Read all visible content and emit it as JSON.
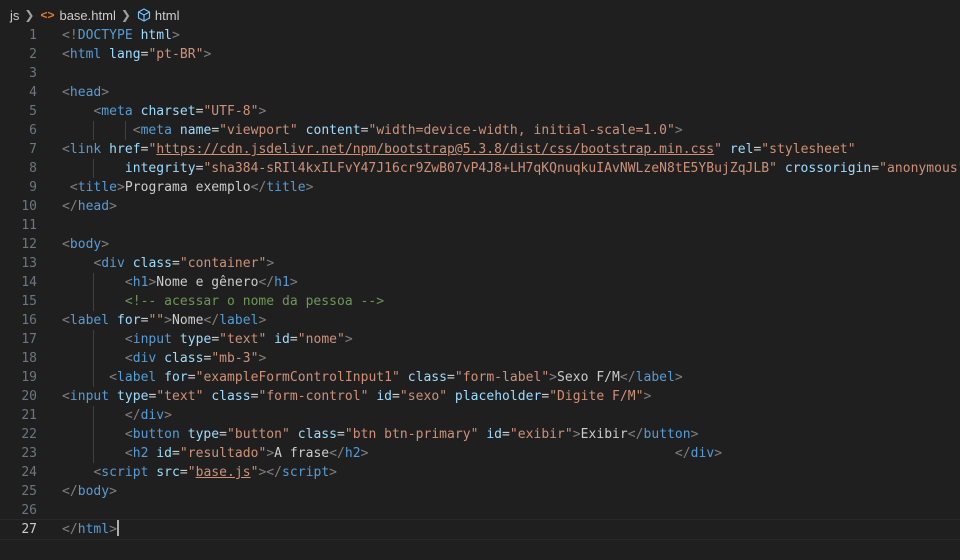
{
  "breadcrumb": {
    "folder": "js",
    "file": "base.html",
    "symbol": "html"
  },
  "editor": {
    "active_line": 27,
    "lines": [
      {
        "n": 1,
        "tokens": [
          [
            "p",
            "<!"
          ],
          [
            "t",
            "DOCTYPE"
          ],
          [
            "x",
            " "
          ],
          [
            "a",
            "html"
          ],
          [
            "p",
            ">"
          ]
        ]
      },
      {
        "n": 2,
        "tokens": [
          [
            "p",
            "<"
          ],
          [
            "t",
            "html"
          ],
          [
            "x",
            " "
          ],
          [
            "a",
            "lang"
          ],
          [
            "x",
            "="
          ],
          [
            "s",
            "\"pt-BR\""
          ],
          [
            "p",
            ">"
          ]
        ]
      },
      {
        "n": 3,
        "tokens": []
      },
      {
        "n": 4,
        "tokens": [
          [
            "p",
            "<"
          ],
          [
            "t",
            "head"
          ],
          [
            "p",
            ">"
          ]
        ]
      },
      {
        "n": 5,
        "tokens": [
          [
            "x",
            "    "
          ],
          [
            "p",
            "<"
          ],
          [
            "t",
            "meta"
          ],
          [
            "x",
            " "
          ],
          [
            "a",
            "charset"
          ],
          [
            "x",
            "="
          ],
          [
            "s",
            "\"UTF-8\""
          ],
          [
            "p",
            ">"
          ]
        ]
      },
      {
        "n": 6,
        "tokens": [
          [
            "x",
            "         "
          ],
          [
            "p",
            "<"
          ],
          [
            "t",
            "meta"
          ],
          [
            "x",
            " "
          ],
          [
            "a",
            "name"
          ],
          [
            "x",
            "="
          ],
          [
            "s",
            "\"viewport\""
          ],
          [
            "x",
            " "
          ],
          [
            "a",
            "content"
          ],
          [
            "x",
            "="
          ],
          [
            "s",
            "\"width=device-width, initial-scale=1.0\""
          ],
          [
            "p",
            ">"
          ]
        ]
      },
      {
        "n": 7,
        "tokens": [
          [
            "p",
            "<"
          ],
          [
            "t",
            "link"
          ],
          [
            "x",
            " "
          ],
          [
            "a",
            "href"
          ],
          [
            "x",
            "="
          ],
          [
            "s",
            "\""
          ],
          [
            "u",
            "https://cdn.jsdelivr.net/npm/bootstrap@5.3.8/dist/css/bootstrap.min.css"
          ],
          [
            "s",
            "\""
          ],
          [
            "x",
            " "
          ],
          [
            "a",
            "rel"
          ],
          [
            "x",
            "="
          ],
          [
            "s",
            "\"stylesheet\""
          ]
        ]
      },
      {
        "n": 8,
        "tokens": [
          [
            "x",
            "        "
          ],
          [
            "a",
            "integrity"
          ],
          [
            "x",
            "="
          ],
          [
            "s",
            "\"sha384-sRIl4kxILFvY47J16cr9ZwB07vP4J8+LH7qKQnuqkuIAvNWLzeN8tE5YBujZqJLB\""
          ],
          [
            "x",
            " "
          ],
          [
            "a",
            "crossorigin"
          ],
          [
            "x",
            "="
          ],
          [
            "s",
            "\"anonymous\""
          ],
          [
            "p",
            ">"
          ]
        ]
      },
      {
        "n": 9,
        "tokens": [
          [
            "x",
            " "
          ],
          [
            "p",
            "<"
          ],
          [
            "t",
            "title"
          ],
          [
            "p",
            ">"
          ],
          [
            "x",
            "Programa exemplo"
          ],
          [
            "p",
            "</"
          ],
          [
            "t",
            "title"
          ],
          [
            "p",
            ">"
          ]
        ]
      },
      {
        "n": 10,
        "tokens": [
          [
            "p",
            "</"
          ],
          [
            "t",
            "head"
          ],
          [
            "p",
            ">"
          ]
        ]
      },
      {
        "n": 11,
        "tokens": []
      },
      {
        "n": 12,
        "tokens": [
          [
            "p",
            "<"
          ],
          [
            "t",
            "body"
          ],
          [
            "p",
            ">"
          ]
        ]
      },
      {
        "n": 13,
        "tokens": [
          [
            "x",
            "    "
          ],
          [
            "p",
            "<"
          ],
          [
            "t",
            "div"
          ],
          [
            "x",
            " "
          ],
          [
            "a",
            "class"
          ],
          [
            "x",
            "="
          ],
          [
            "s",
            "\"container\""
          ],
          [
            "p",
            ">"
          ]
        ]
      },
      {
        "n": 14,
        "tokens": [
          [
            "x",
            "        "
          ],
          [
            "p",
            "<"
          ],
          [
            "t",
            "h1"
          ],
          [
            "p",
            ">"
          ],
          [
            "x",
            "Nome e gênero"
          ],
          [
            "p",
            "</"
          ],
          [
            "t",
            "h1"
          ],
          [
            "p",
            ">"
          ]
        ]
      },
      {
        "n": 15,
        "tokens": [
          [
            "x",
            "        "
          ],
          [
            "c",
            "<!-- acessar o nome da pessoa -->"
          ]
        ]
      },
      {
        "n": 16,
        "tokens": [
          [
            "p",
            "<"
          ],
          [
            "t",
            "label"
          ],
          [
            "x",
            " "
          ],
          [
            "a",
            "for"
          ],
          [
            "x",
            "="
          ],
          [
            "s",
            "\"\""
          ],
          [
            "p",
            ">"
          ],
          [
            "x",
            "Nome"
          ],
          [
            "p",
            "</"
          ],
          [
            "t",
            "label"
          ],
          [
            "p",
            ">"
          ]
        ]
      },
      {
        "n": 17,
        "tokens": [
          [
            "x",
            "        "
          ],
          [
            "p",
            "<"
          ],
          [
            "t",
            "input"
          ],
          [
            "x",
            " "
          ],
          [
            "a",
            "type"
          ],
          [
            "x",
            "="
          ],
          [
            "s",
            "\"text\""
          ],
          [
            "x",
            " "
          ],
          [
            "a",
            "id"
          ],
          [
            "x",
            "="
          ],
          [
            "s",
            "\"nome\""
          ],
          [
            "p",
            ">"
          ]
        ]
      },
      {
        "n": 18,
        "tokens": [
          [
            "x",
            "        "
          ],
          [
            "p",
            "<"
          ],
          [
            "t",
            "div"
          ],
          [
            "x",
            " "
          ],
          [
            "a",
            "class"
          ],
          [
            "x",
            "="
          ],
          [
            "s",
            "\"mb-3\""
          ],
          [
            "p",
            ">"
          ]
        ]
      },
      {
        "n": 19,
        "tokens": [
          [
            "x",
            "      "
          ],
          [
            "p",
            "<"
          ],
          [
            "t",
            "label"
          ],
          [
            "x",
            " "
          ],
          [
            "a",
            "for"
          ],
          [
            "x",
            "="
          ],
          [
            "s",
            "\"exampleFormControlInput1\""
          ],
          [
            "x",
            " "
          ],
          [
            "a",
            "class"
          ],
          [
            "x",
            "="
          ],
          [
            "s",
            "\"form-label\""
          ],
          [
            "p",
            ">"
          ],
          [
            "x",
            "Sexo F/M"
          ],
          [
            "p",
            "</"
          ],
          [
            "t",
            "label"
          ],
          [
            "p",
            ">"
          ]
        ]
      },
      {
        "n": 20,
        "tokens": [
          [
            "p",
            "<"
          ],
          [
            "t",
            "input"
          ],
          [
            "x",
            " "
          ],
          [
            "a",
            "type"
          ],
          [
            "x",
            "="
          ],
          [
            "s",
            "\"text\""
          ],
          [
            "x",
            " "
          ],
          [
            "a",
            "class"
          ],
          [
            "x",
            "="
          ],
          [
            "s",
            "\"form-control\""
          ],
          [
            "x",
            " "
          ],
          [
            "a",
            "id"
          ],
          [
            "x",
            "="
          ],
          [
            "s",
            "\"sexo\""
          ],
          [
            "x",
            " "
          ],
          [
            "a",
            "placeholder"
          ],
          [
            "x",
            "="
          ],
          [
            "s",
            "\"Digite F/M\""
          ],
          [
            "p",
            ">"
          ]
        ]
      },
      {
        "n": 21,
        "tokens": [
          [
            "x",
            "        "
          ],
          [
            "p",
            "</"
          ],
          [
            "t",
            "div"
          ],
          [
            "p",
            ">"
          ]
        ]
      },
      {
        "n": 22,
        "tokens": [
          [
            "x",
            "        "
          ],
          [
            "p",
            "<"
          ],
          [
            "t",
            "button"
          ],
          [
            "x",
            " "
          ],
          [
            "a",
            "type"
          ],
          [
            "x",
            "="
          ],
          [
            "s",
            "\"button\""
          ],
          [
            "x",
            " "
          ],
          [
            "a",
            "class"
          ],
          [
            "x",
            "="
          ],
          [
            "s",
            "\"btn btn-primary\""
          ],
          [
            "x",
            " "
          ],
          [
            "a",
            "id"
          ],
          [
            "x",
            "="
          ],
          [
            "s",
            "\"exibir\""
          ],
          [
            "p",
            ">"
          ],
          [
            "x",
            "Exibir"
          ],
          [
            "p",
            "</"
          ],
          [
            "t",
            "button"
          ],
          [
            "p",
            ">"
          ]
        ]
      },
      {
        "n": 23,
        "tokens": [
          [
            "x",
            "        "
          ],
          [
            "p",
            "<"
          ],
          [
            "t",
            "h2"
          ],
          [
            "x",
            " "
          ],
          [
            "a",
            "id"
          ],
          [
            "x",
            "="
          ],
          [
            "s",
            "\"resultado\""
          ],
          [
            "p",
            ">"
          ],
          [
            "x",
            "A frase"
          ],
          [
            "p",
            "</"
          ],
          [
            "t",
            "h2"
          ],
          [
            "p",
            ">"
          ],
          [
            "x",
            "                                       "
          ],
          [
            "p",
            "</"
          ],
          [
            "t",
            "div"
          ],
          [
            "p",
            ">"
          ]
        ]
      },
      {
        "n": 24,
        "tokens": [
          [
            "x",
            "    "
          ],
          [
            "p",
            "<"
          ],
          [
            "t",
            "script"
          ],
          [
            "x",
            " "
          ],
          [
            "a",
            "src"
          ],
          [
            "x",
            "="
          ],
          [
            "s",
            "\""
          ],
          [
            "u",
            "base.js"
          ],
          [
            "s",
            "\""
          ],
          [
            "p",
            "></"
          ],
          [
            "t",
            "script"
          ],
          [
            "p",
            ">"
          ]
        ]
      },
      {
        "n": 25,
        "tokens": [
          [
            "p",
            "</"
          ],
          [
            "t",
            "body"
          ],
          [
            "p",
            ">"
          ]
        ]
      },
      {
        "n": 26,
        "tokens": []
      },
      {
        "n": 27,
        "tokens": [
          [
            "p",
            "</"
          ],
          [
            "t",
            "html"
          ],
          [
            "p",
            ">"
          ]
        ]
      }
    ]
  }
}
